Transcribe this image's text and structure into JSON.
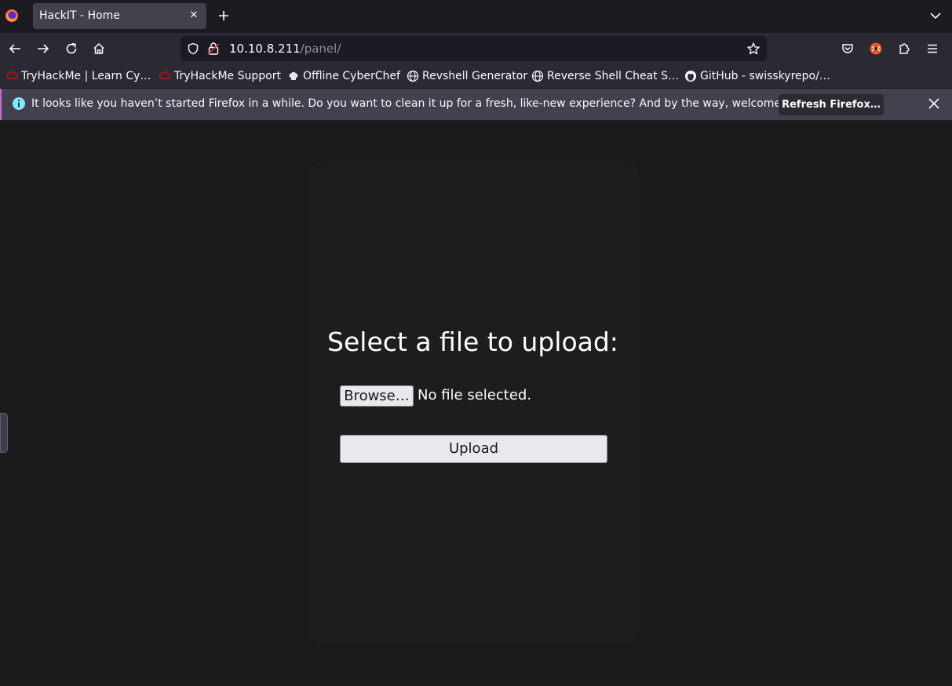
{
  "browser": {
    "tab": {
      "title": "HackIT - Home"
    },
    "url": {
      "host": "10.10.8.211",
      "path": "/panel/"
    },
    "bookmarks": [
      {
        "label": "TryHackMe | Learn Cy…",
        "icon": "tryhackme-icon"
      },
      {
        "label": "TryHackMe Support",
        "icon": "tryhackme-icon"
      },
      {
        "label": "Offline CyberChef",
        "icon": "chef-hat-icon"
      },
      {
        "label": "Revshell Generator",
        "icon": "globe-icon"
      },
      {
        "label": "Reverse Shell Cheat S…",
        "icon": "globe-icon"
      },
      {
        "label": "GitHub - swisskyrepo/…",
        "icon": "github-icon"
      }
    ],
    "notification": {
      "text": "It looks like you haven’t started Firefox in a while. Do you want to clean it up for a fresh, like-new experience? And by the way, welcome back!",
      "button": "Refresh Firefox…",
      "accent": "#c86bd4"
    }
  },
  "page": {
    "heading": "Select a file to upload:",
    "browse_label": "Browse…",
    "file_status": "No file selected.",
    "upload_label": "Upload"
  },
  "colors": {
    "page_background": "#1b1b1b",
    "button_background": "#e9e9ed",
    "tryhackme_red": "#c11111"
  }
}
